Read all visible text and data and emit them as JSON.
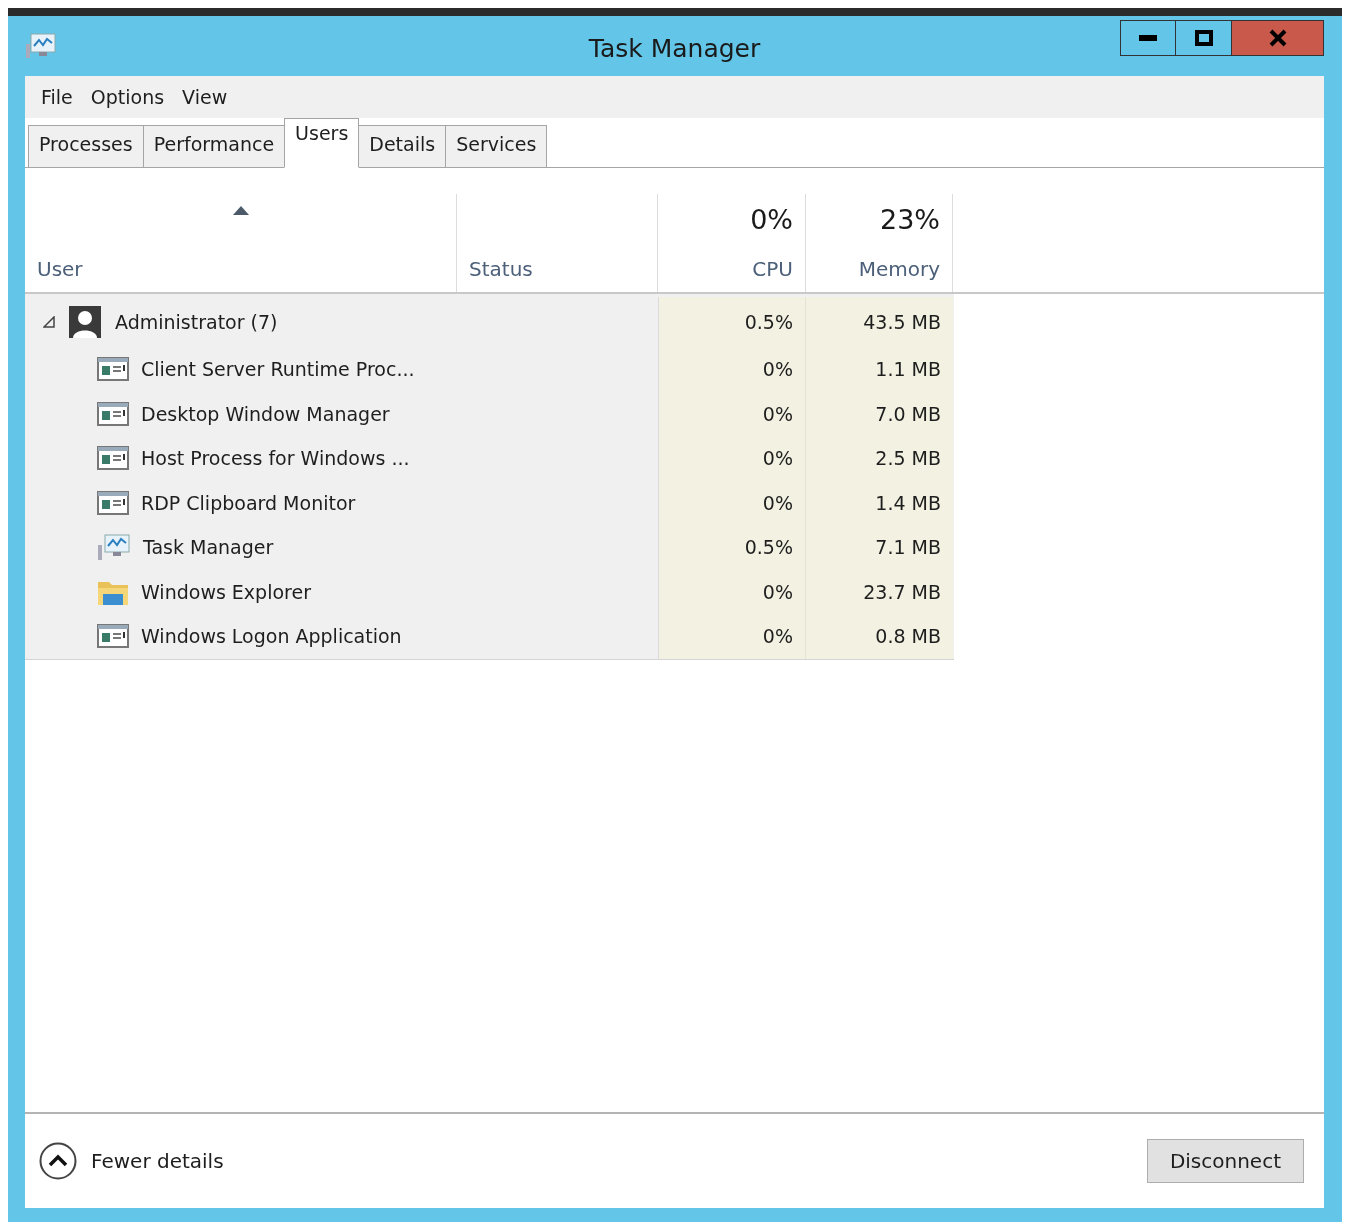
{
  "window": {
    "title": "Task Manager"
  },
  "menu": [
    "File",
    "Options",
    "View"
  ],
  "tabs": [
    {
      "label": "Processes",
      "selected": false
    },
    {
      "label": "Performance",
      "selected": false
    },
    {
      "label": "Users",
      "selected": true
    },
    {
      "label": "Details",
      "selected": false
    },
    {
      "label": "Services",
      "selected": false
    }
  ],
  "table": {
    "columns": [
      {
        "label": "User",
        "sorted": true
      },
      {
        "label": "Status",
        "sorted": false
      },
      {
        "label": "CPU",
        "sorted": false,
        "summary": "0%"
      },
      {
        "label": "Memory",
        "sorted": false,
        "summary": "23%"
      }
    ],
    "rows": [
      {
        "name": "Administrator (7)",
        "expanded": true,
        "cpu": "0.5%",
        "memory": "43.5 MB",
        "children": [
          {
            "name": "Client Server Runtime Proc...",
            "kind": "app",
            "cpu": "0%",
            "memory": "1.1 MB"
          },
          {
            "name": "Desktop Window Manager",
            "kind": "app",
            "cpu": "0%",
            "memory": "7.0 MB"
          },
          {
            "name": "Host Process for Windows ...",
            "kind": "app",
            "cpu": "0%",
            "memory": "2.5 MB"
          },
          {
            "name": "RDP Clipboard Monitor",
            "kind": "app",
            "cpu": "0%",
            "memory": "1.4 MB"
          },
          {
            "name": "Task Manager",
            "kind": "monitor",
            "cpu": "0.5%",
            "memory": "7.1 MB"
          },
          {
            "name": "Windows Explorer",
            "kind": "folder",
            "cpu": "0%",
            "memory": "23.7 MB"
          },
          {
            "name": "Windows Logon Application",
            "kind": "app",
            "cpu": "0%",
            "memory": "0.8 MB"
          }
        ]
      }
    ]
  },
  "footer": {
    "toggle": "Fewer details",
    "button": "Disconnect"
  }
}
